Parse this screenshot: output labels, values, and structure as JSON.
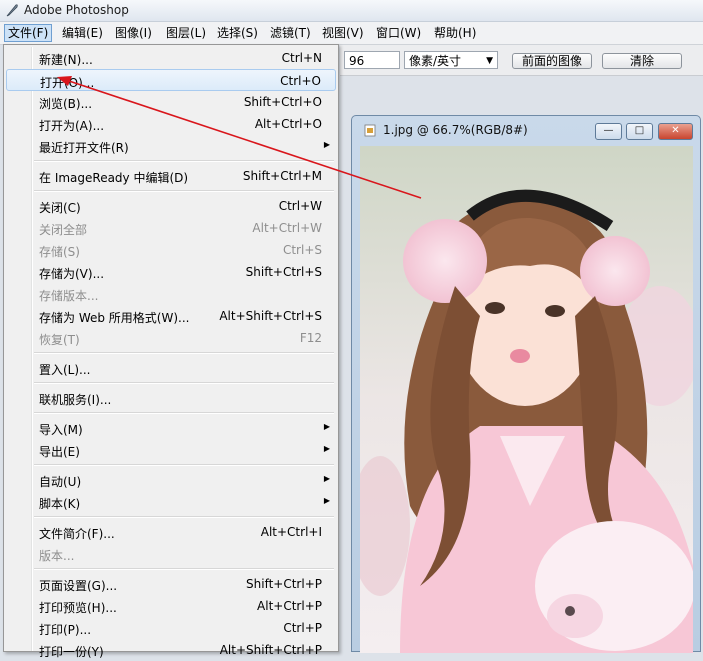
{
  "app": {
    "title": "Adobe Photoshop"
  },
  "menubar": [
    {
      "label": "文件(F)",
      "active": true
    },
    {
      "label": "编辑(E)"
    },
    {
      "label": "图像(I)"
    },
    {
      "label": "图层(L)"
    },
    {
      "label": "选择(S)"
    },
    {
      "label": "滤镜(T)"
    },
    {
      "label": "视图(V)"
    },
    {
      "label": "窗口(W)"
    },
    {
      "label": "帮助(H)"
    }
  ],
  "options_bar": {
    "resolution_value": "96",
    "unit_select": "像素/英寸",
    "front_image_button": "前面的图像",
    "clear_button": "清除"
  },
  "file_menu": {
    "items": [
      {
        "label": "新建(N)...",
        "shortcut": "Ctrl+N"
      },
      {
        "label": "打开(O)...",
        "shortcut": "Ctrl+O",
        "highlighted": true
      },
      {
        "label": "浏览(B)...",
        "shortcut": "Shift+Ctrl+O"
      },
      {
        "label": "打开为(A)...",
        "shortcut": "Alt+Ctrl+O"
      },
      {
        "label": "最近打开文件(R)",
        "submenu": true
      },
      {
        "separator": true
      },
      {
        "label": "在 ImageReady 中编辑(D)",
        "shortcut": "Shift+Ctrl+M"
      },
      {
        "separator": true
      },
      {
        "label": "关闭(C)",
        "shortcut": "Ctrl+W"
      },
      {
        "label": "关闭全部",
        "shortcut": "Alt+Ctrl+W",
        "disabled": true
      },
      {
        "label": "存储(S)",
        "shortcut": "Ctrl+S",
        "disabled": true
      },
      {
        "label": "存储为(V)...",
        "shortcut": "Shift+Ctrl+S"
      },
      {
        "label": "存储版本...",
        "disabled": true
      },
      {
        "label": "存储为 Web 所用格式(W)...",
        "shortcut": "Alt+Shift+Ctrl+S"
      },
      {
        "label": "恢复(T)",
        "shortcut": "F12",
        "disabled": true
      },
      {
        "separator": true
      },
      {
        "label": "置入(L)..."
      },
      {
        "separator": true
      },
      {
        "label": "联机服务(I)..."
      },
      {
        "separator": true
      },
      {
        "label": "导入(M)",
        "submenu": true
      },
      {
        "label": "导出(E)",
        "submenu": true
      },
      {
        "separator": true
      },
      {
        "label": "自动(U)",
        "submenu": true
      },
      {
        "label": "脚本(K)",
        "submenu": true
      },
      {
        "separator": true
      },
      {
        "label": "文件简介(F)...",
        "shortcut": "Alt+Ctrl+I"
      },
      {
        "label": "版本...",
        "disabled": true
      },
      {
        "separator": true
      },
      {
        "label": "页面设置(G)...",
        "shortcut": "Shift+Ctrl+P"
      },
      {
        "label": "打印预览(H)...",
        "shortcut": "Alt+Ctrl+P"
      },
      {
        "label": "打印(P)...",
        "shortcut": "Ctrl+P"
      },
      {
        "label": "打印一份(Y)",
        "shortcut": "Alt+Shift+Ctrl+P"
      }
    ]
  },
  "document": {
    "title": "1.jpg @ 66.7%(RGB/8#)",
    "image_description": "photo"
  },
  "window_buttons": {
    "minimize": "—",
    "maximize": "□",
    "close": "✕"
  },
  "colors": {
    "annotation_arrow": "#d9161c",
    "menu_hover": "#dcebfa"
  }
}
